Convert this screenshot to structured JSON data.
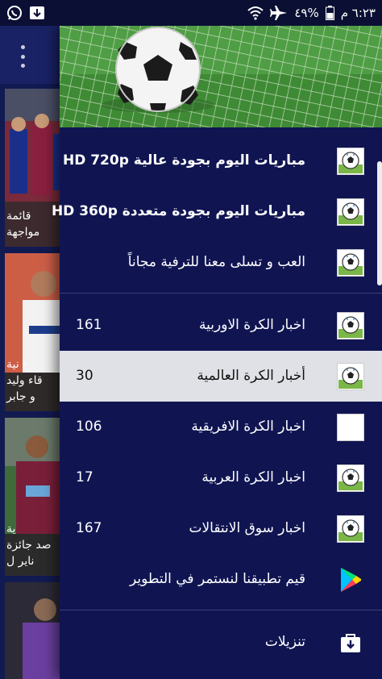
{
  "status_bar": {
    "time": "٦:٢٣ م",
    "battery": "٤٩%",
    "icons": [
      "whatsapp-icon",
      "download-icon",
      "wifi-icon",
      "airplane-icon",
      "battery-icon"
    ]
  },
  "background_cards": [
    {
      "caption_line1": "قائمة",
      "caption_line2": "مواجهة"
    },
    {
      "caption_line1": "نية -",
      "caption_line2": "قاء وليد",
      "caption_line3": "و جابر"
    },
    {
      "caption_line1": "ية",
      "caption_line2": "صد جائزة",
      "caption_line3": "ناير ل"
    }
  ],
  "drawer": {
    "top_items": [
      {
        "label": "مباريات اليوم بجودة عالية HD 720p",
        "icon": "ball-icon"
      },
      {
        "label": "مباريات اليوم بجودة متعددة HD 360p",
        "icon": "ball-icon"
      },
      {
        "label": "العب و تسلى معنا للترفية مجاناً",
        "icon": "ball-icon"
      }
    ],
    "news_items": [
      {
        "label": "اخبار الكرة الاوربية",
        "count": "161",
        "icon": "ball-icon"
      },
      {
        "label": "أخبار الكرة العالمية",
        "count": "30",
        "icon": "ball-icon",
        "selected": true
      },
      {
        "label": "اخبار الكرة الافريقية",
        "count": "106",
        "icon": "blank-icon"
      },
      {
        "label": "اخبار الكرة العربية",
        "count": "17",
        "icon": "ball-icon"
      },
      {
        "label": "اخبار سوق الانتقالات",
        "count": "167",
        "icon": "ball-icon"
      },
      {
        "label": "قيم تطبيقنا لنستمر في التطوير",
        "count": "",
        "icon": "play-store-icon"
      }
    ],
    "bottom_items": [
      {
        "label": "تنزيلات",
        "icon": "download-bag-icon"
      }
    ]
  },
  "colors": {
    "drawer_bg": "#101552",
    "selected_bg": "#e0e1e6",
    "status_bar_bg": "#0b0f33"
  }
}
